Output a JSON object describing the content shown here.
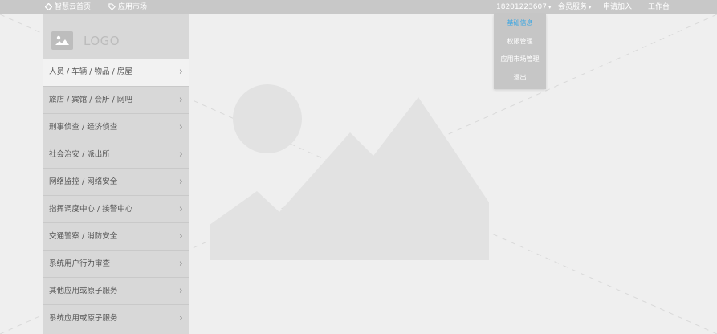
{
  "topbar": {
    "home_label": "智慧云首页",
    "market_label": "应用市场",
    "phone": "18201223607",
    "member_service": "会员服务",
    "apply_join": "申请加入",
    "workbench": "工作台"
  },
  "user_menu": {
    "items": [
      "基础信息",
      "权限管理",
      "应用市场管理",
      "退出"
    ],
    "active_index": 0
  },
  "sidebar": {
    "logo_text": "LOGO",
    "items": [
      "人员 / 车辆 / 物品 / 房屋",
      "旅店 / 宾馆 / 会所 / 网吧",
      "刑事侦查 / 经济侦查",
      "社会治安 / 派出所",
      "网络监控 / 网络安全",
      "指挥调度中心 / 接警中心",
      "交通警察 / 消防安全",
      "系统用户行为审查",
      "其他应用或原子服务",
      "系统应用或原子服务"
    ]
  },
  "colors": {
    "topbar_bg": "#c8c8c8",
    "sidebar_bg": "#d8d8d8",
    "active_link": "#3aa6e3"
  },
  "icons": {
    "home": "diamond-icon",
    "market": "tag-icon",
    "caret": "chevron-down-icon",
    "menu_arrow": "chevron-right-icon",
    "logo": "image-placeholder-icon"
  }
}
